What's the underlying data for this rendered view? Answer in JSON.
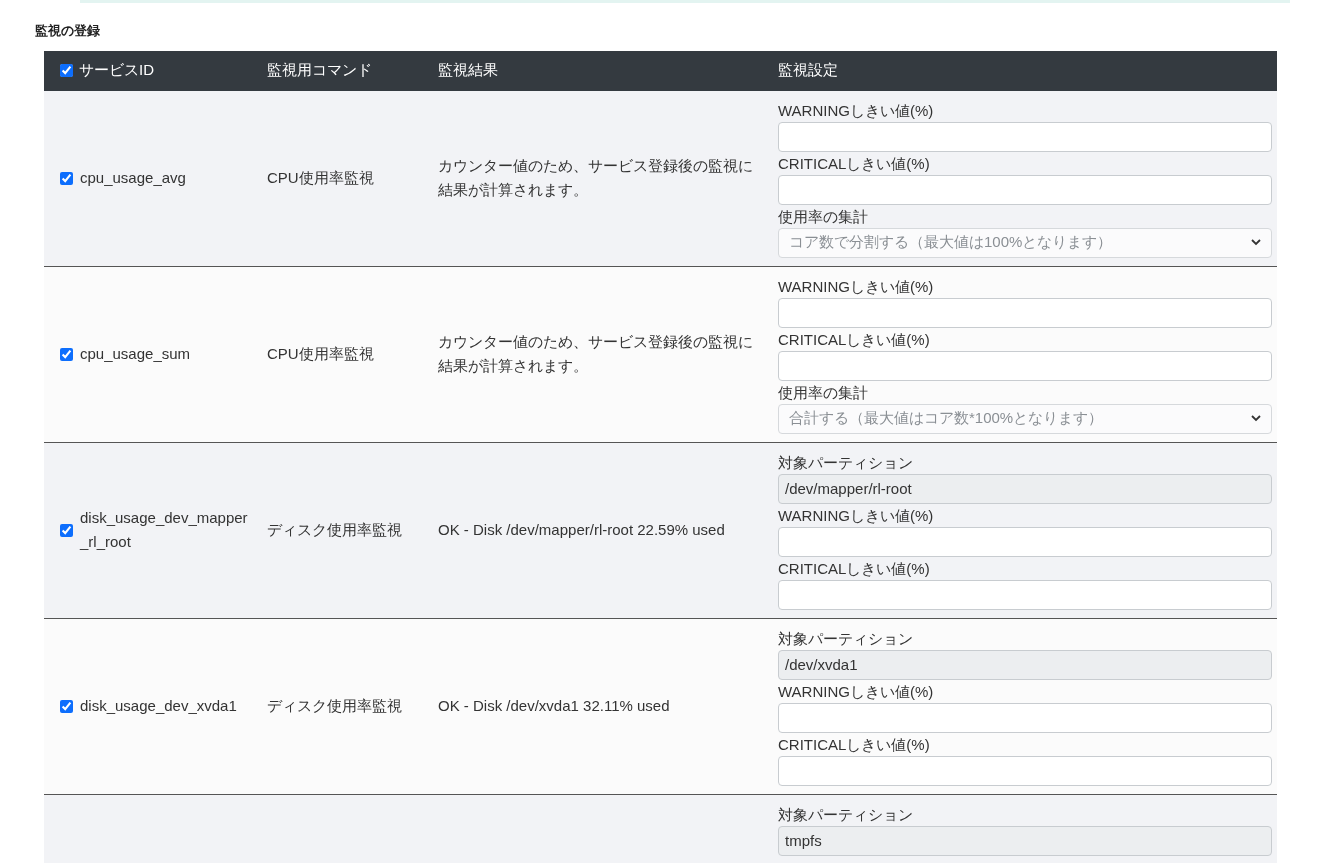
{
  "section_title": "監視の登録",
  "table": {
    "select_all": {
      "checked": true
    },
    "columns": [
      "サービスID",
      "監視用コマンド",
      "監視結果",
      "監視設定"
    ],
    "rows": [
      {
        "checked": true,
        "service_id": "cpu_usage_avg",
        "command": "CPU使用率監視",
        "result": "カウンター値のため、サービス登録後の監視に結果が計算されます。",
        "settings": [
          {
            "kind": "input",
            "label": "WARNINGしきい値(%)"
          },
          {
            "kind": "input",
            "label": "CRITICALしきい値(%)"
          },
          {
            "kind": "select",
            "label": "使用率の集計",
            "value": "コア数で分割する（最大値は100%となります）"
          }
        ]
      },
      {
        "checked": true,
        "service_id": "cpu_usage_sum",
        "command": "CPU使用率監視",
        "result": "カウンター値のため、サービス登録後の監視に結果が計算されます。",
        "settings": [
          {
            "kind": "input",
            "label": "WARNINGしきい値(%)"
          },
          {
            "kind": "input",
            "label": "CRITICALしきい値(%)"
          },
          {
            "kind": "select",
            "label": "使用率の集計",
            "value": "合計する（最大値はコア数*100%となります）"
          }
        ]
      },
      {
        "checked": true,
        "service_id": "disk_usage_dev_mapper_rl_root",
        "command": "ディスク使用率監視",
        "result": "OK - Disk /dev/mapper/rl-root 22.59% used",
        "settings": [
          {
            "kind": "readonly",
            "label": "対象パーティション",
            "value": "/dev/mapper/rl-root"
          },
          {
            "kind": "input",
            "label": "WARNINGしきい値(%)"
          },
          {
            "kind": "input",
            "label": "CRITICALしきい値(%)"
          }
        ]
      },
      {
        "checked": true,
        "service_id": "disk_usage_dev_xvda1",
        "command": "ディスク使用率監視",
        "result": "OK - Disk /dev/xvda1 32.11% used",
        "settings": [
          {
            "kind": "readonly",
            "label": "対象パーティション",
            "value": "/dev/xvda1"
          },
          {
            "kind": "input",
            "label": "WARNINGしきい値(%)"
          },
          {
            "kind": "input",
            "label": "CRITICALしきい値(%)"
          }
        ]
      },
      {
        "settings": [
          {
            "kind": "readonly",
            "label": "対象パーティション",
            "value": "tmpfs"
          }
        ]
      }
    ]
  }
}
